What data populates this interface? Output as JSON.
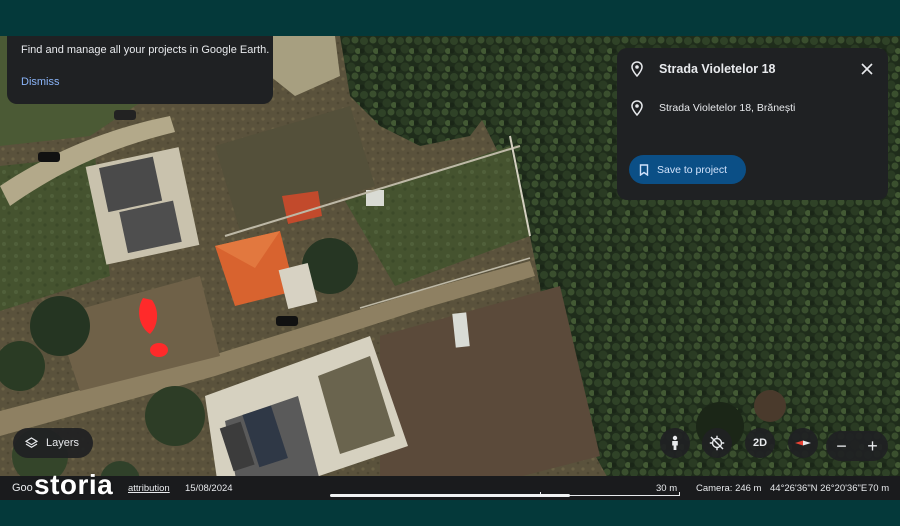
{
  "promo": {
    "message": "Find and manage all your projects in Google Earth.",
    "dismiss_label": "Dismiss"
  },
  "place_panel": {
    "title": "Strada Violetelor 18",
    "address": "Strada Violetelor 18, Brănești",
    "save_label": "Save to project"
  },
  "controls": {
    "layers_label": "Layers",
    "view_mode_label": "2D",
    "zoom_out_label": "−",
    "zoom_in_label": "+"
  },
  "status_bar": {
    "logo_text": "Goo",
    "data_attribution_label": "attribution",
    "imagery_date": "15/08/2024",
    "scale_label": "30 m",
    "camera": "Camera: 246 m",
    "coordinates": "44°26'36\"N 26°20'36\"E",
    "altitude": "70 m"
  },
  "watermark": {
    "text": "storia"
  },
  "colors": {
    "panel_bg": "#1f2123",
    "accent_button": "#0b4f86",
    "link_blue": "#8ab4f8",
    "marker_red": "#ff2a2a",
    "frame_bg": "#04393a"
  },
  "icons": {
    "place_pin": "location-pin-icon",
    "close": "close-icon",
    "bookmark": "bookmark-icon",
    "layers": "layers-icon",
    "street_view": "pegman-icon",
    "tilt": "gps-off-icon",
    "compass": "compass-icon"
  }
}
